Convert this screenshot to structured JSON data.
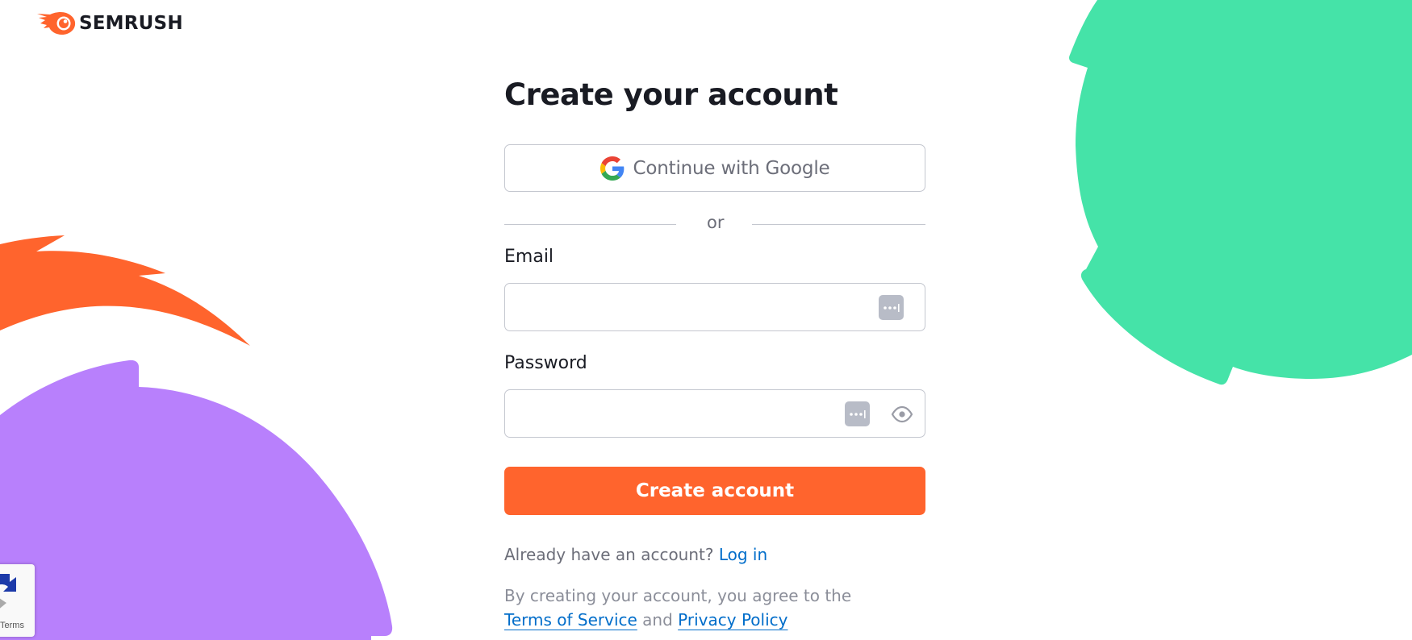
{
  "brand": {
    "name": "SEMRUSH",
    "logo_icon": "semrush-flame-icon",
    "accent_color": "#ff642d"
  },
  "decorations": {
    "green_color": "#45e3a8",
    "orange_color": "#ff642d",
    "purple_color": "#b880fc"
  },
  "form": {
    "title": "Create your account",
    "google_button": {
      "label": "Continue with Google",
      "icon": "google-g-icon"
    },
    "divider_text": "or",
    "email": {
      "label": "Email",
      "value": "",
      "placeholder": "",
      "icon": "password-manager-icon"
    },
    "password": {
      "label": "Password",
      "value": "",
      "placeholder": "",
      "icons": [
        "password-manager-icon",
        "eye-icon"
      ]
    },
    "submit_label": "Create account",
    "login_prompt": {
      "text": "Already have an account?",
      "link": "Log in"
    },
    "legal": {
      "text": "By creating your account, you agree to the",
      "terms_link": "Terms of Service",
      "and": "and",
      "privacy_link": "Privacy Policy"
    }
  },
  "recaptcha": {
    "terms_label": "Terms"
  }
}
